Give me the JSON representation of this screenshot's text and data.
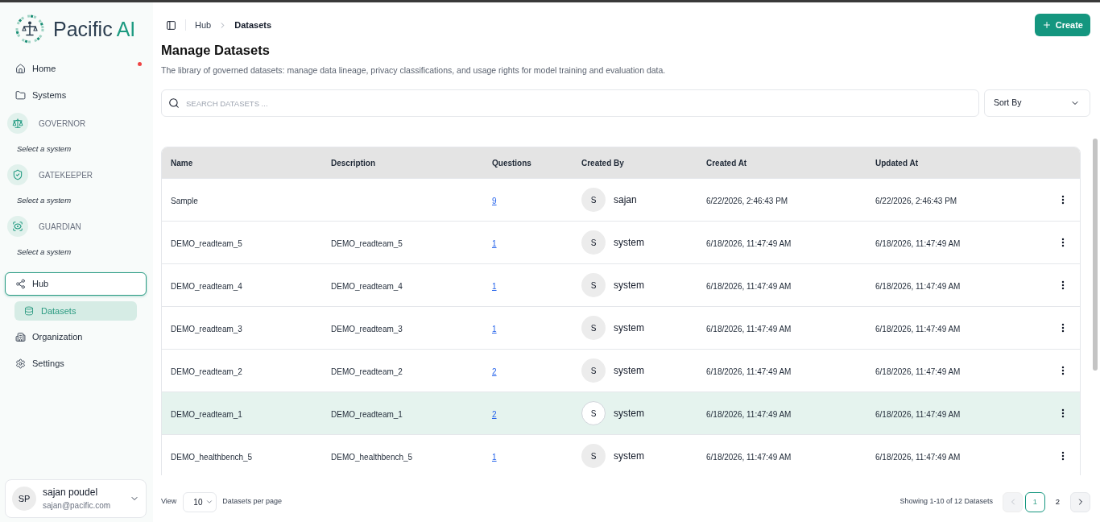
{
  "logo": {
    "name": "Pacific",
    "accent": "AI"
  },
  "sidebar": {
    "items": [
      {
        "kind": "link",
        "label": "Home",
        "selected": false,
        "notification": true
      },
      {
        "kind": "link",
        "label": "Systems",
        "selected": false,
        "notification": false
      },
      {
        "kind": "system",
        "label": "GOVERNOR",
        "caption": "Select a system",
        "selected": false,
        "notification": false
      },
      {
        "kind": "system",
        "label": "GATEKEEPER",
        "caption": "Select a system",
        "selected": false,
        "notification": false
      },
      {
        "kind": "system",
        "label": "GUARDIAN",
        "caption": "Select a system",
        "selected": false,
        "notification": false
      },
      {
        "kind": "group",
        "label": "Hub",
        "selected": true,
        "notification": false,
        "children": [
          {
            "label": "Datasets",
            "selected": true
          }
        ]
      },
      {
        "kind": "link",
        "label": "Organization",
        "selected": false,
        "notification": false
      },
      {
        "kind": "link",
        "label": "Settings",
        "selected": false,
        "notification": false
      }
    ]
  },
  "user": {
    "initials": "SP",
    "name": "sajan poudel",
    "email": "sajan@pacific.com"
  },
  "header": {
    "breadcrumb": [
      {
        "label": "Hub",
        "current": false
      },
      {
        "label": "Datasets",
        "current": true
      }
    ],
    "create_button": "Create"
  },
  "page": {
    "title": "Manage Datasets",
    "description": "The library of governed datasets: manage data lineage, privacy classifications, and usage rights for model training and evaluation data.",
    "search": {
      "placeholder": "SEARCH DATASETS ..."
    },
    "sort": {
      "label": "Sort By"
    }
  },
  "table": {
    "columns": [
      "Name",
      "Description",
      "Questions",
      "Created By",
      "Created At",
      "Updated At"
    ],
    "rows": [
      {
        "name": "Sample",
        "questions": "9",
        "creator": {
          "initial": "S",
          "name": "sajan"
        },
        "created_at": "6/22/2026, 2:46:43 PM",
        "updated_at": "6/22/2026, 2:46:43 PM",
        "highlighted": false
      },
      {
        "name": "DEMO_readteam_5",
        "description": "DEMO_readteam_5",
        "questions": "1",
        "creator": {
          "initial": "S",
          "name": "system"
        },
        "created_at": "6/18/2026, 11:47:49 AM",
        "updated_at": "6/18/2026, 11:47:49 AM",
        "highlighted": false
      },
      {
        "name": "DEMO_readteam_4",
        "description": "DEMO_readteam_4",
        "questions": "1",
        "creator": {
          "initial": "S",
          "name": "system"
        },
        "created_at": "6/18/2026, 11:47:49 AM",
        "updated_at": "6/18/2026, 11:47:49 AM",
        "highlighted": false
      },
      {
        "name": "DEMO_readteam_3",
        "description": "DEMO_readteam_3",
        "questions": "1",
        "creator": {
          "initial": "S",
          "name": "system"
        },
        "created_at": "6/18/2026, 11:47:49 AM",
        "updated_at": "6/18/2026, 11:47:49 AM",
        "highlighted": false
      },
      {
        "name": "DEMO_readteam_2",
        "description": "DEMO_readteam_2",
        "questions": "2",
        "creator": {
          "initial": "S",
          "name": "system"
        },
        "created_at": "6/18/2026, 11:47:49 AM",
        "updated_at": "6/18/2026, 11:47:49 AM",
        "highlighted": false
      },
      {
        "name": "DEMO_readteam_1",
        "description": "DEMO_readteam_1",
        "questions": "2",
        "creator": {
          "initial": "S",
          "name": "system"
        },
        "created_at": "6/18/2026, 11:47:49 AM",
        "updated_at": "6/18/2026, 11:47:49 AM",
        "highlighted": true
      },
      {
        "name": "DEMO_healthbench_5",
        "description": "DEMO_healthbench_5",
        "questions": "1",
        "creator": {
          "initial": "S",
          "name": "system"
        },
        "created_at": "6/18/2026, 11:47:49 AM",
        "updated_at": "6/18/2026, 11:47:49 AM",
        "highlighted": false
      }
    ]
  },
  "footer": {
    "view_label": "View",
    "page_size": "10",
    "per_page_label": "Datasets per page",
    "summary": "Showing 1-10 of 12 Datasets",
    "previous": {
      "disabled": true
    },
    "pages": [
      {
        "label": "1",
        "selected": true
      },
      {
        "label": "2",
        "selected": false
      }
    ],
    "next": {
      "disabled": false
    }
  }
}
